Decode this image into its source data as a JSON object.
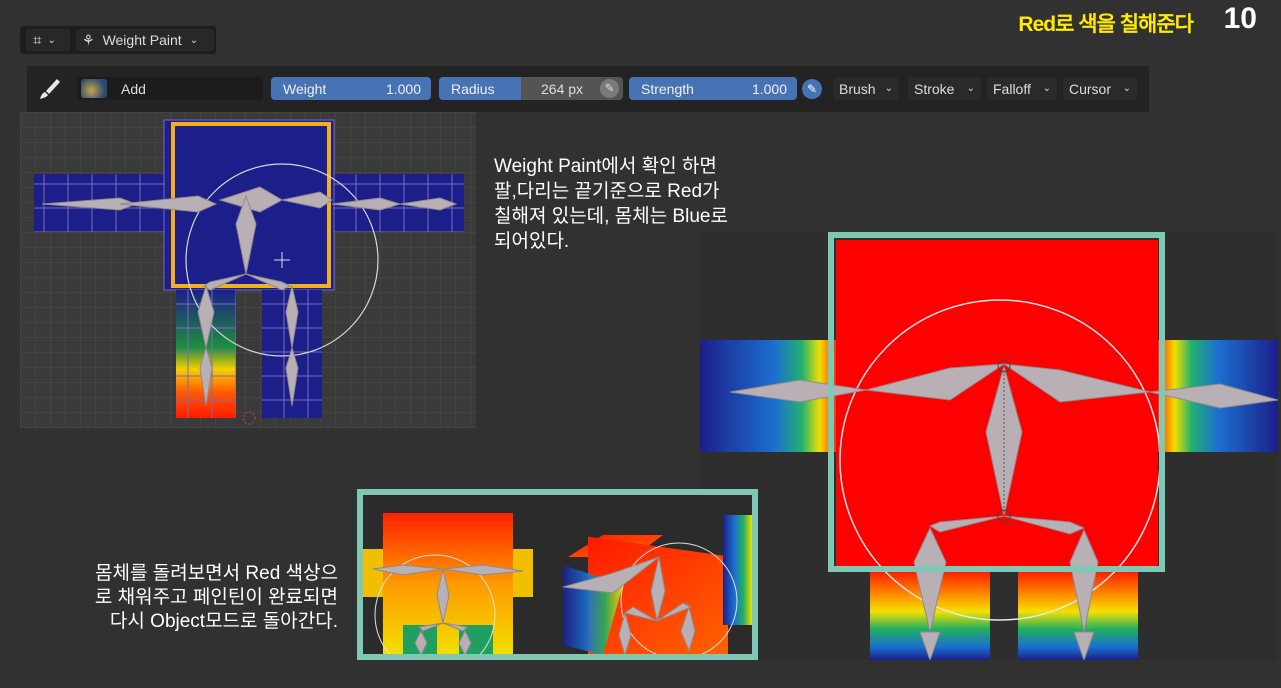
{
  "header": {
    "title": "Red로 색을 칠해준다",
    "page_number": "10"
  },
  "modebar": {
    "mode_label": "Weight Paint"
  },
  "toolbar": {
    "brush_name": "Add",
    "weight_label": "Weight",
    "weight_value": "1.000",
    "radius_label": "Radius",
    "radius_value": "264 px",
    "strength_label": "Strength",
    "strength_value": "1.000",
    "menus": [
      "Brush",
      "Stroke",
      "Falloff",
      "Cursor"
    ]
  },
  "annotations": {
    "top_lines": [
      "Weight Paint에서 확인 하면",
      "팔,다리는 끝기준으로 Red가",
      "칠해져 있는데, 몸체는 Blue로",
      "되어있다."
    ],
    "bottom_lines": [
      "몸체를 돌려보면서 Red 색상으",
      "로 채워주고 페인틴이 완료되면",
      "다시 Object모드로 돌아간다."
    ]
  },
  "colors": {
    "title": "#ffea00",
    "frame": "#7fc8b6",
    "highlight": "#f2b01e",
    "weight_blue": "#1c1f8a",
    "weight_red": "#ff0000",
    "field_blue": "#4772b3"
  }
}
